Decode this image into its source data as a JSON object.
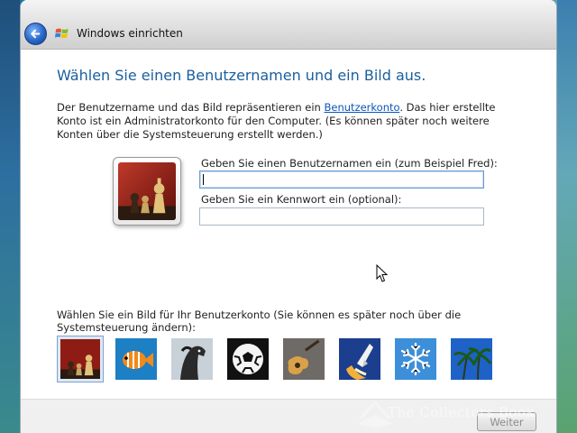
{
  "titlebar": {
    "title": "Windows einrichten",
    "back_icon": "back-arrow-icon",
    "logo_icon": "windows-flag-icon"
  },
  "page": {
    "heading": "Wählen Sie einen Benutzernamen und ein Bild aus.",
    "intro_part1": "Der Benutzername und das Bild repräsentieren ein ",
    "intro_link": "Benutzerkonto",
    "intro_part2": ". Das hier erstellte Konto ist ein Administratorkonto für den Computer. (Es können später noch weitere Konten über die Systemsteuerung erstellt werden.)"
  },
  "form": {
    "username_label": "Geben Sie einen Benutzernamen ein (zum Beispiel Fred):",
    "username_value": "",
    "password_label": "Geben Sie ein Kennwort ein (optional):",
    "password_value": ""
  },
  "pictures": {
    "label": "Wählen Sie ein Bild für Ihr Benutzerkonto (Sie können es später noch über die Systemsteuerung ändern):",
    "selected_index": 0,
    "items": [
      {
        "name": "chess"
      },
      {
        "name": "fish"
      },
      {
        "name": "horse"
      },
      {
        "name": "soccer-ball"
      },
      {
        "name": "guitar"
      },
      {
        "name": "space-shuttle"
      },
      {
        "name": "snowflake"
      },
      {
        "name": "palm-trees"
      }
    ]
  },
  "footer": {
    "next_label": "Weiter"
  },
  "watermark": {
    "text": "The Collectors Book"
  },
  "colors": {
    "heading": "#1a5f9e",
    "link": "#0b58b8",
    "selection": "#dce8f6"
  }
}
